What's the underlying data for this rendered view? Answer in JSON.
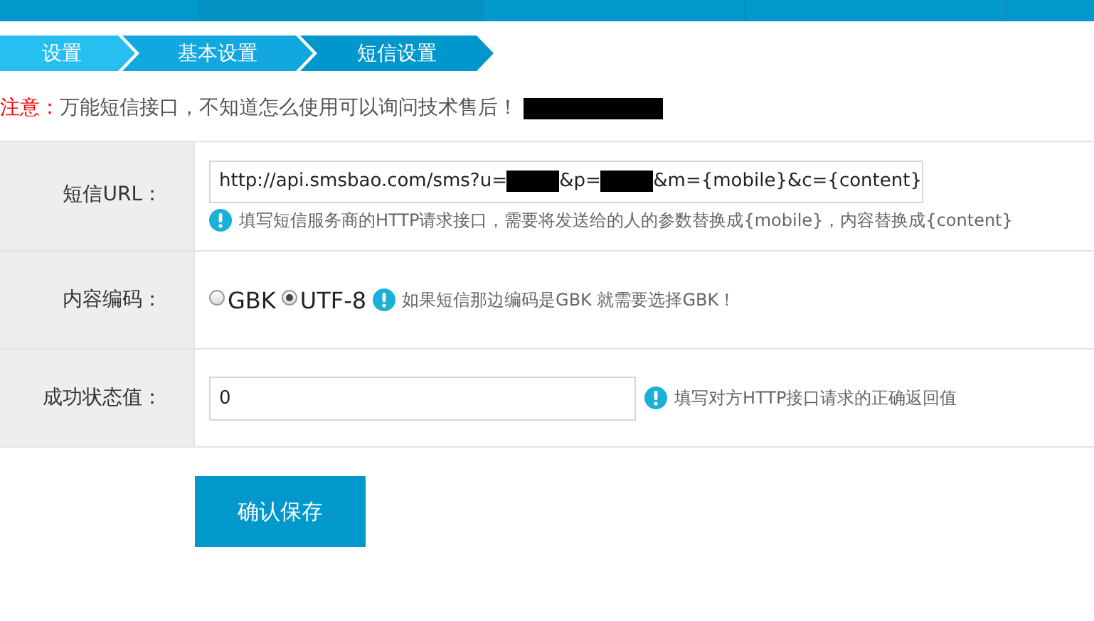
{
  "breadcrumb": [
    {
      "label": "设置"
    },
    {
      "label": "基本设置"
    },
    {
      "label": "短信设置"
    }
  ],
  "notice": {
    "prefix": "注意：",
    "text": "万能短信接口，不知道怎么使用可以询问技术售后！"
  },
  "form": [
    {
      "kind": "url",
      "label": "短信URL：",
      "parts": [
        {
          "kind": "text",
          "text": "http://api.smsbao.com/sms?u="
        },
        {
          "kind": "redacted"
        },
        {
          "kind": "text",
          "text": "&p="
        },
        {
          "kind": "redacted"
        },
        {
          "kind": "text",
          "text": "&m={mobile}&c={content}"
        }
      ],
      "hint": "填写短信服务商的HTTP请求接口，需要将发送给的人的参数替换成{mobile}，内容替换成{content}"
    },
    {
      "kind": "radio",
      "label": "内容编码：",
      "options": [
        {
          "label": "GBK",
          "selected": false
        },
        {
          "label": "UTF-8",
          "selected": true
        }
      ],
      "hint": "如果短信那边编码是GBK 就需要选择GBK！"
    },
    {
      "kind": "input",
      "label": "成功状态值：",
      "value": "0",
      "hint": "填写对方HTTP接口请求的正确返回值"
    }
  ],
  "submit": "确认保存"
}
